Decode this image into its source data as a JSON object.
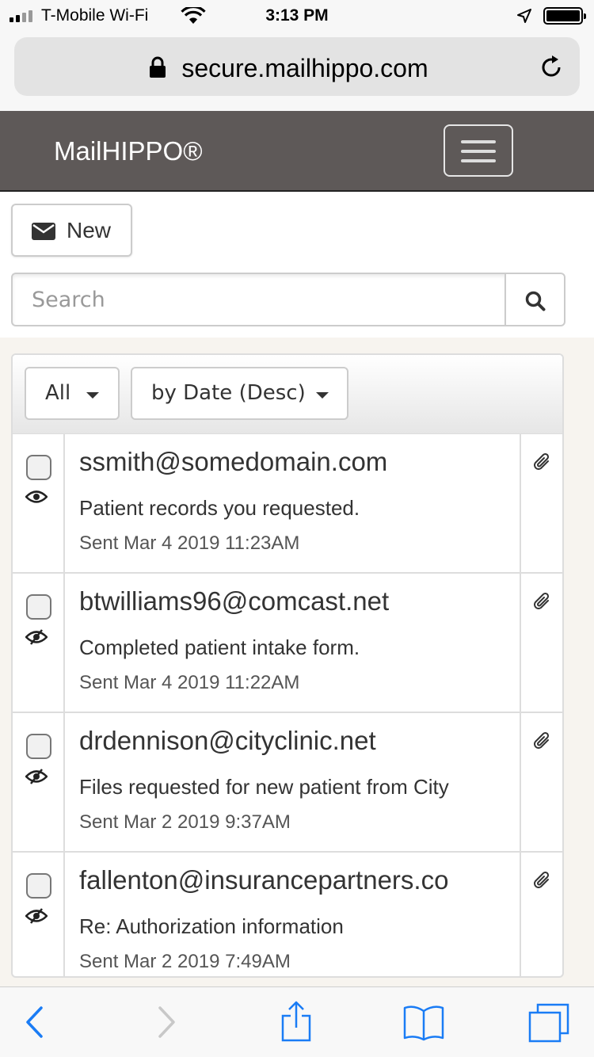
{
  "status_bar": {
    "carrier": "T-Mobile Wi-Fi",
    "time": "3:13 PM",
    "battery_level": 1.0
  },
  "browser": {
    "url": "secure.mailhippo.com",
    "icons": [
      "lock-icon",
      "reload-icon",
      "back-icon",
      "forward-icon",
      "share-icon",
      "bookmarks-icon",
      "tabs-icon"
    ]
  },
  "navbar": {
    "brand": "MailHIPPO®",
    "background": "#5e5958"
  },
  "toolbar": {
    "new_label": "New",
    "search_placeholder": "Search"
  },
  "filters": {
    "folder_selected": "All",
    "sort_selected": "by Date (Desc)"
  },
  "messages": [
    {
      "from": "ssmith@somedomain.com",
      "subject": "Patient records you requested.",
      "date": "Sent Mar 4 2019 11:23AM",
      "read_state": "read",
      "has_attachment": true
    },
    {
      "from": "btwilliams96@comcast.net",
      "subject": "Completed patient intake form.",
      "date": "Sent Mar 4 2019 11:22AM",
      "read_state": "unread",
      "has_attachment": true
    },
    {
      "from": "drdennison@cityclinic.net",
      "subject": "Files requested for new patient from City",
      "date": "Sent Mar 2 2019 9:37AM",
      "read_state": "unread",
      "has_attachment": true
    },
    {
      "from": "fallenton@insurancepartners.co",
      "subject": "Re: Authorization information",
      "date": "Sent Mar 2 2019 7:49AM",
      "read_state": "unread",
      "has_attachment": true
    }
  ]
}
